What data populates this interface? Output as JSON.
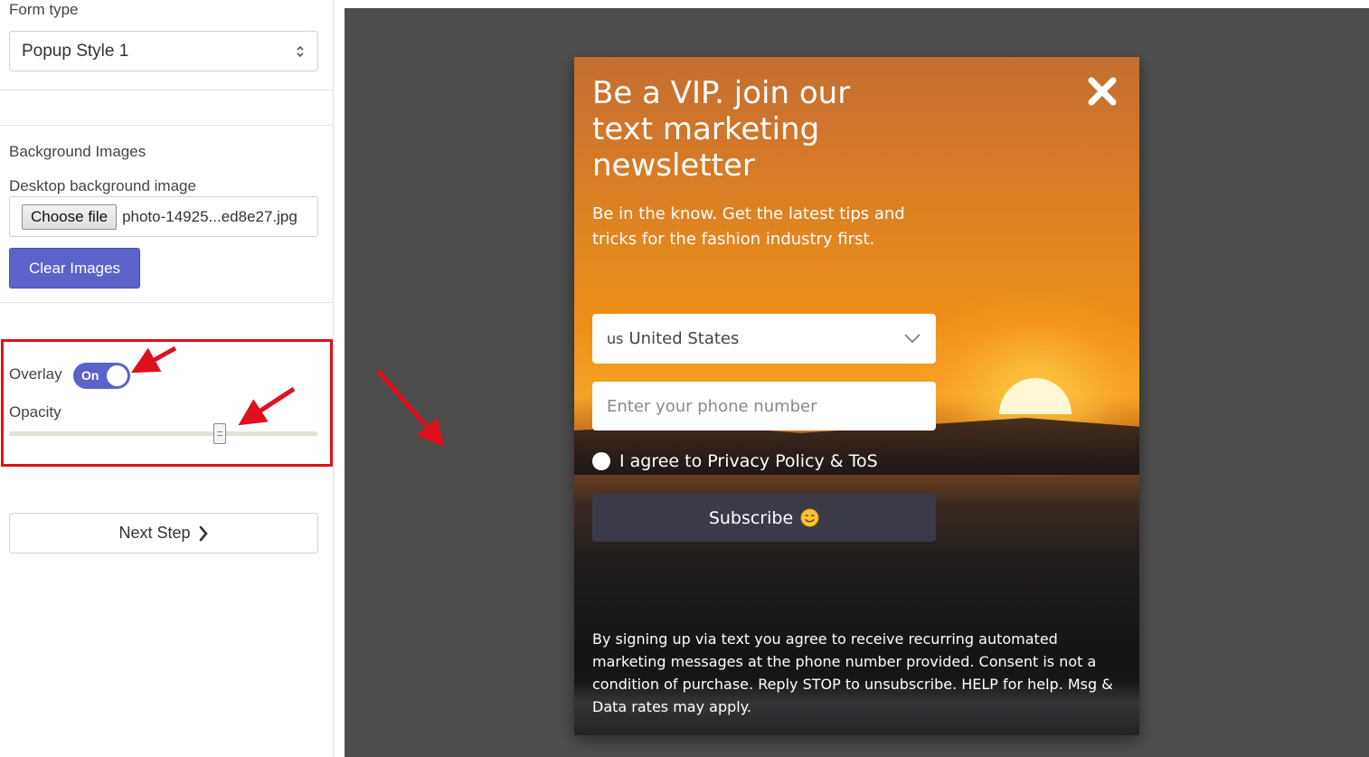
{
  "sidebar": {
    "form_type_label": "Form type",
    "form_type_value": "Popup Style 1",
    "background_images_heading": "Background Images",
    "desktop_bg_label": "Desktop background image",
    "choose_file_label": "Choose file",
    "file_name": "photo-14925...ed8e27.jpg",
    "clear_images_label": "Clear Images",
    "overlay_label": "Overlay",
    "overlay_toggle_text": "On",
    "opacity_label": "Opacity",
    "opacity_fraction": 0.69,
    "next_step_label": "Next Step"
  },
  "popup": {
    "title": "Be a VIP. join our text marketing newsletter",
    "subtitle": "Be in the know. Get the latest tips and tricks for the fashion industry first.",
    "country_code": "us",
    "country_name": "United States",
    "phone_placeholder": "Enter your phone number",
    "agree_text": "I agree to Privacy Policy & ToS",
    "subscribe_label": "Subscribe",
    "disclaimer": "By signing up via text you agree to receive recurring automated marketing messages at the phone number provided. Consent is not a condition of purchase. Reply STOP to unsubscribe. HELP for help. Msg & Data rates may apply."
  },
  "colors": {
    "accent": "#5c62c9",
    "annotation_red": "#e0101e",
    "preview_bg": "#4e4e4e",
    "subscribe_bg": "#3a3a48"
  },
  "icons": [
    "select-updown-icon",
    "chevron-right-icon",
    "close-icon",
    "chevron-down-icon",
    "smile-emoji-icon",
    "annotation-arrow"
  ]
}
